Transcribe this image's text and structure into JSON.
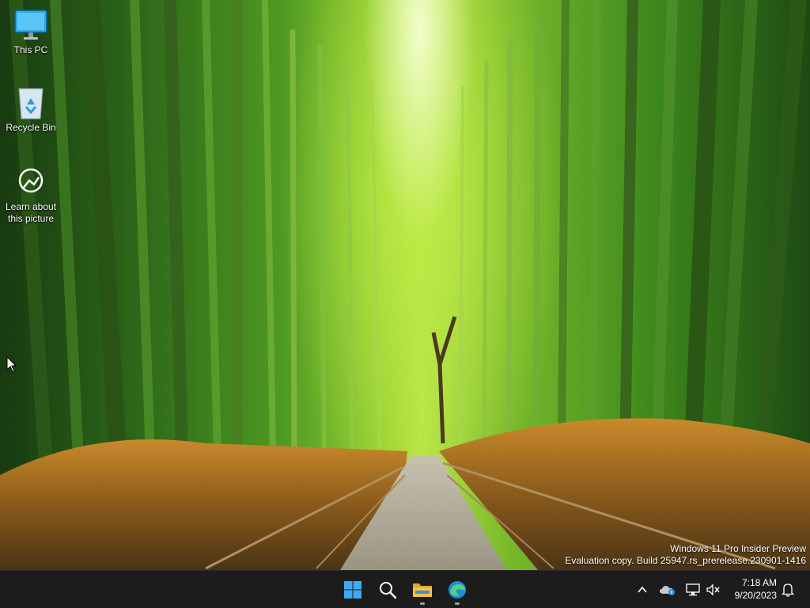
{
  "desktop": {
    "icons": [
      {
        "label": "This PC"
      },
      {
        "label": "Recycle Bin"
      },
      {
        "label_line1": "Learn about",
        "label_line2": "this picture"
      }
    ],
    "watermark": {
      "line1": "Windows 11 Pro Insider Preview",
      "line2": "Evaluation copy. Build 25947.rs_prerelease.230901-1416"
    }
  },
  "taskbar": {
    "apps": [
      {
        "icon": "windows-start-icon"
      },
      {
        "icon": "search-icon"
      },
      {
        "icon": "file-explorer-icon",
        "running": true
      },
      {
        "icon": "edge-icon",
        "running": true
      }
    ],
    "tray": {
      "icons": [
        "chevron-up-icon",
        "onedrive-icon",
        "network-icon",
        "volume-muted-icon",
        "notification-bell-icon"
      ]
    },
    "clock": {
      "time": "7:18 AM",
      "date": "9/20/2023"
    }
  },
  "colors": {
    "taskbar_bg": "#1c1c1c",
    "start_blue": "#3fa9f5",
    "explorer_yellow": "#f5c242"
  }
}
